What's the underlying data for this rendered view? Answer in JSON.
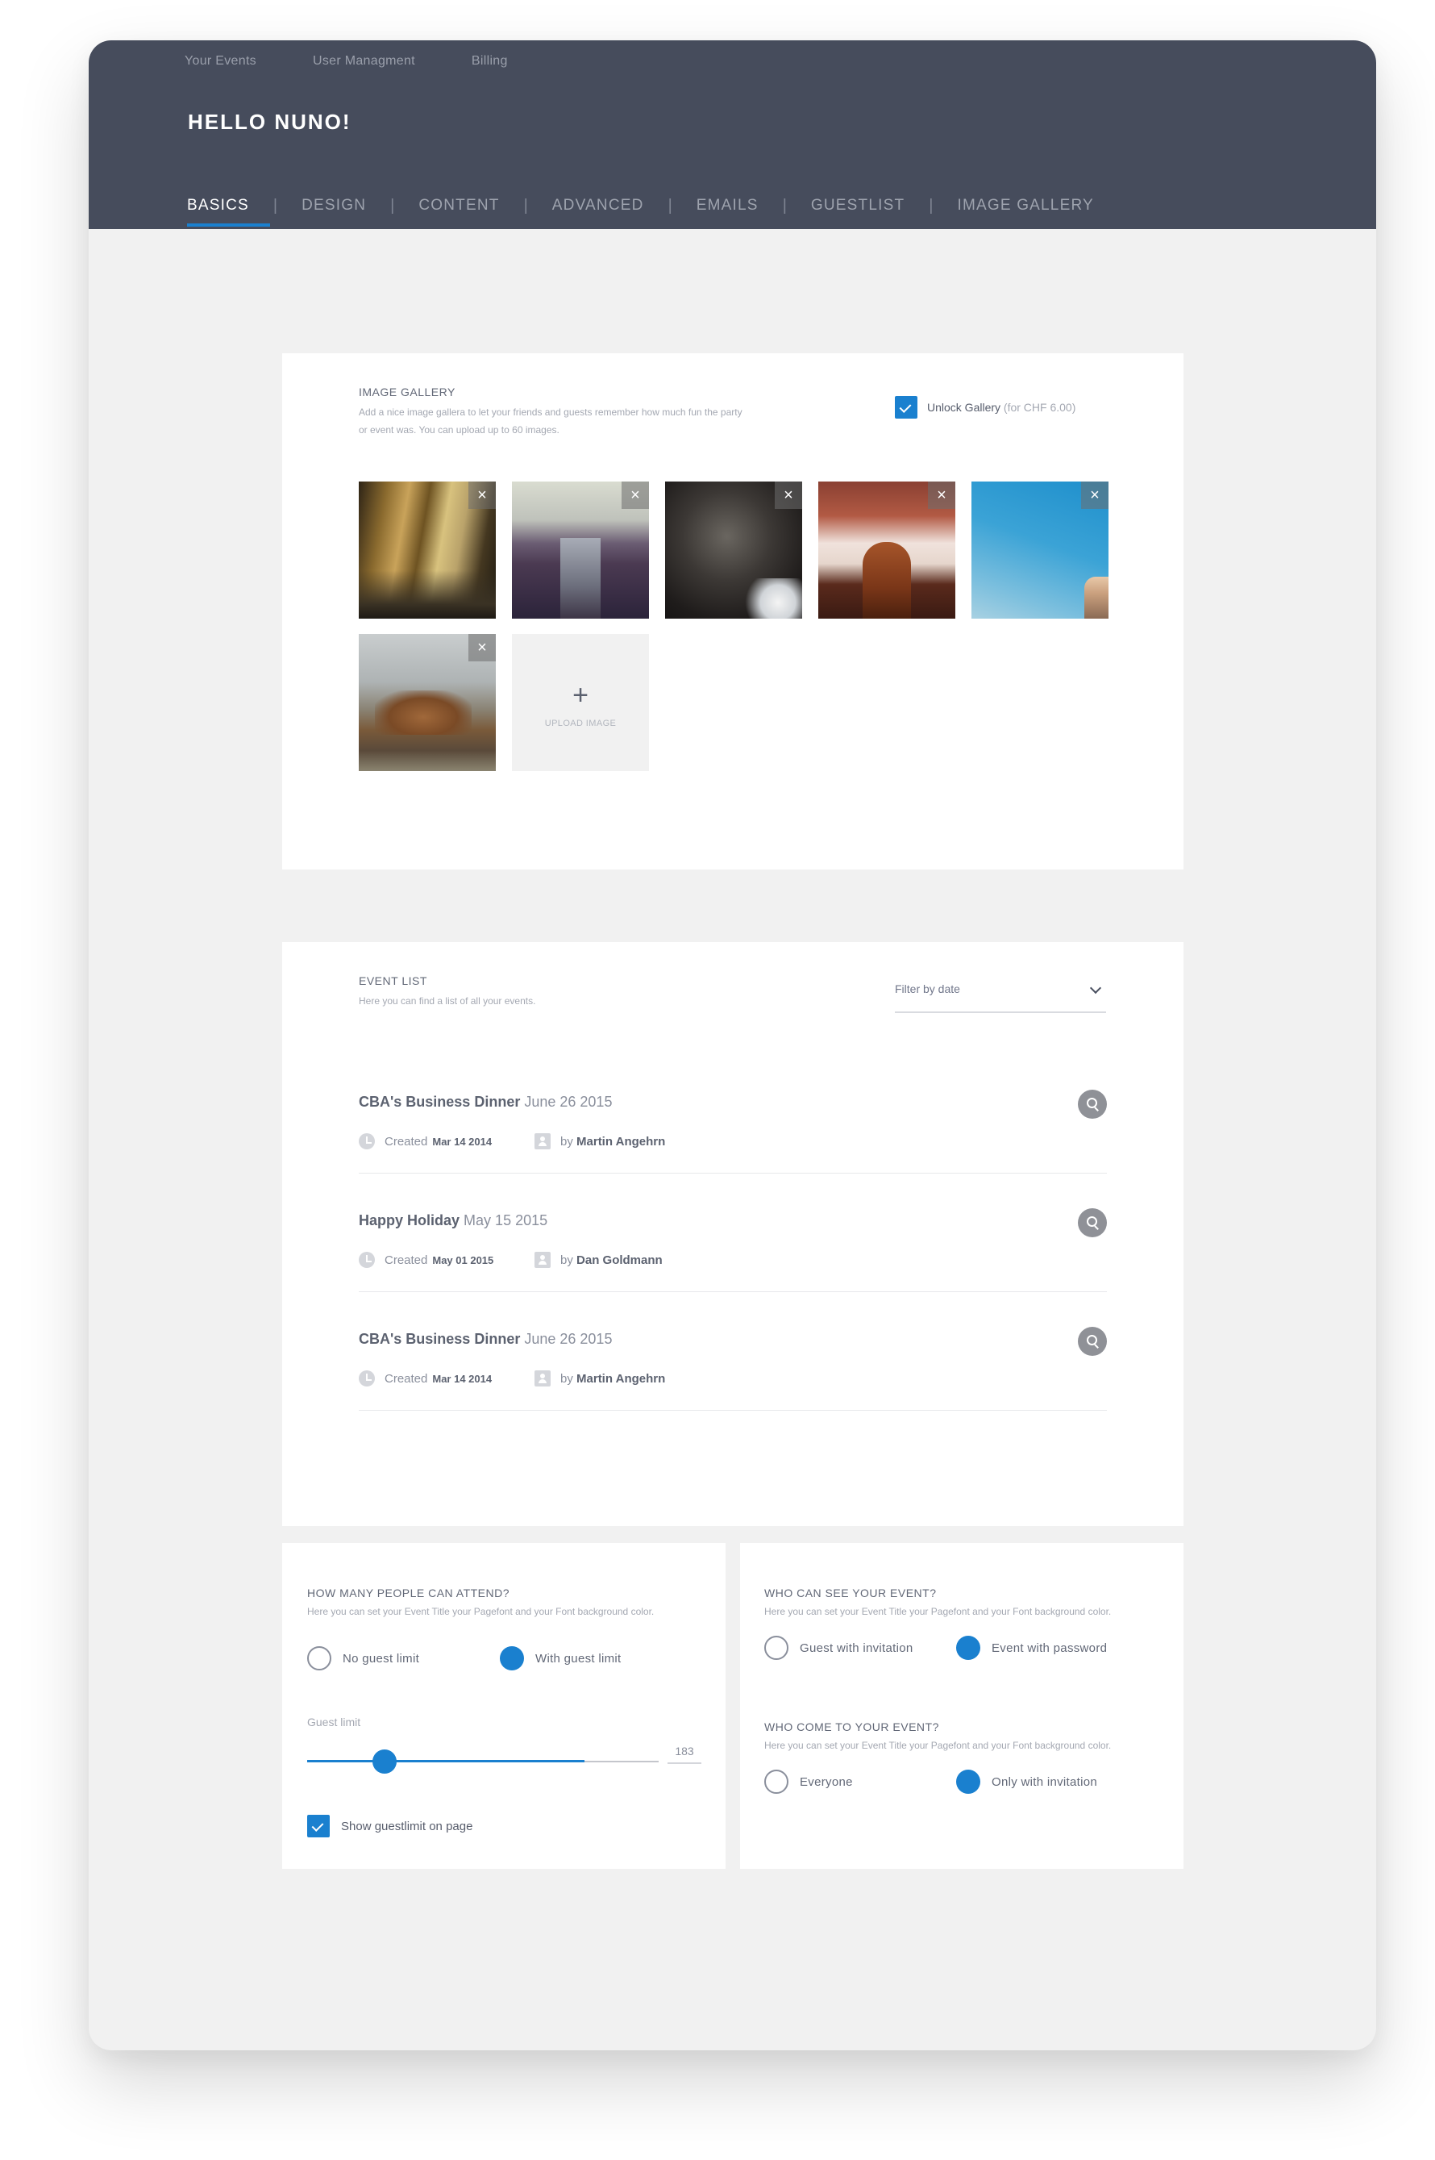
{
  "topnav": [
    "Your Events",
    "User Managment",
    "Billing"
  ],
  "greeting": "HELLO NUNO!",
  "tabs": [
    "BASICS",
    "DESIGN",
    "CONTENT",
    "ADVANCED",
    "EMAILS",
    "GUESTLIST",
    "IMAGE GALLERY"
  ],
  "colors": {
    "header": "#464c5c",
    "accent": "#1a80cf",
    "background": "#f1f1f1"
  },
  "gallery": {
    "title": "IMAGE GALLERY",
    "description": "Add a nice image gallera to let your friends and guests remember how much fun the party or event was. You can upload up to 60 images.",
    "unlock_label": "Unlock Gallery",
    "unlock_price": "(for CHF 6.00)",
    "unlock_checked": true,
    "close_glyph": "×",
    "upload_icon": "+",
    "upload_label": "UPLOAD IMAGE"
  },
  "events": {
    "title": "EVENT LIST",
    "description": "Here you can find a list of all your events.",
    "filter_label": "Filter by date",
    "created_prefix": "Created",
    "by_prefix": "by",
    "items": [
      {
        "name": "CBA's Business Dinner",
        "date": "June 26 2015",
        "created": "Mar 14 2014",
        "author": "Martin Angehrn"
      },
      {
        "name": "Happy Holiday",
        "date": "May 15 2015",
        "created": "May 01 2015",
        "author": "Dan Goldmann"
      },
      {
        "name": "CBA's Business Dinner",
        "date": "June 26 2015",
        "created": "Mar 14 2014",
        "author": "Martin Angehrn"
      }
    ]
  },
  "attendance": {
    "title": "HOW MANY PEOPLE CAN ATTEND?",
    "description": "Here you can set your Event Title your Pagefont and your Font background color.",
    "option_no_limit": "No guest limit",
    "option_with_limit": "With guest limit",
    "slider_label": "Guest limit",
    "slider_value": "183",
    "slider_fraction": 0.22,
    "slider_range_fraction": 0.79,
    "show_limit_label": "Show guestlimit on page",
    "show_limit_checked": true
  },
  "visibility": {
    "title": "WHO CAN SEE YOUR EVENT?",
    "description": "Here you can set your Event Title your Pagefont and your Font background color.",
    "option_invitation": "Guest with invitation",
    "option_password": "Event with password"
  },
  "audience": {
    "title": "WHO COME TO YOUR EVENT?",
    "description": "Here you can set your Event Title your Pagefont and your Font background color.",
    "option_everyone": "Everyone",
    "option_invitation": "Only with invitation"
  }
}
